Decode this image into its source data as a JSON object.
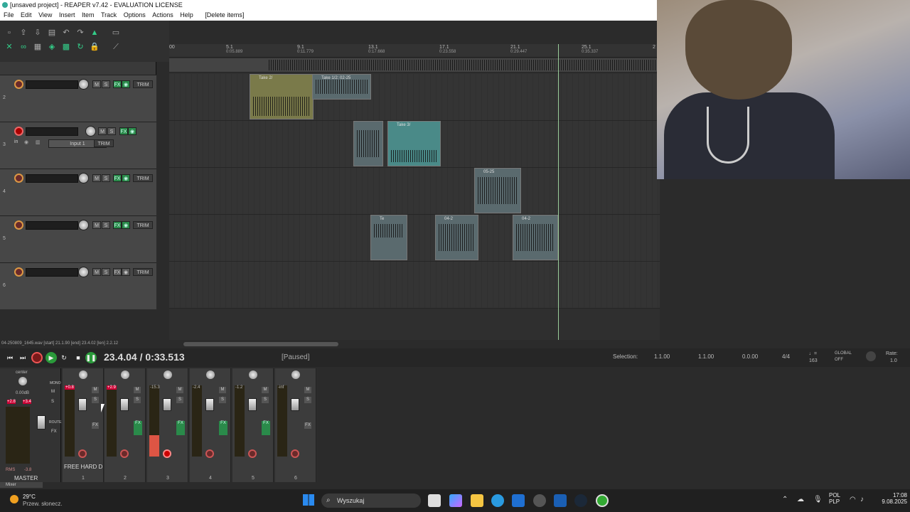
{
  "window": {
    "title": "[unsaved project] - REAPER v7.42 - EVALUATION LICENSE"
  },
  "menu": [
    "File",
    "Edit",
    "View",
    "Insert",
    "Item",
    "Track",
    "Options",
    "Actions",
    "Help",
    "[Delete items]"
  ],
  "ruler": {
    "ticks": [
      {
        "bar": "00",
        "time": ""
      },
      {
        "bar": "5.1",
        "time": "0:05.889"
      },
      {
        "bar": "9.1",
        "time": "0:11.779"
      },
      {
        "bar": "13.1",
        "time": "0:17.668"
      },
      {
        "bar": "17.1",
        "time": "0:23.558"
      },
      {
        "bar": "21.1",
        "time": "0:29.447"
      },
      {
        "bar": "25.1",
        "time": "0:35.337"
      },
      {
        "bar": "2",
        "time": ""
      }
    ]
  },
  "tracks": [
    {
      "num": "2",
      "armed": false,
      "trim": "TRIM"
    },
    {
      "num": "3",
      "armed": true,
      "trim": "TRIM",
      "input": "Input 1",
      "in_label": "in"
    },
    {
      "num": "4",
      "armed": false,
      "trim": "TRIM"
    },
    {
      "num": "5",
      "armed": false,
      "trim": "TRIM"
    },
    {
      "num": "6",
      "armed": false,
      "trim": "TRIM"
    }
  ],
  "items": [
    {
      "label": "Take 2/",
      "lane": 0
    },
    {
      "label": "Take 1/2: 02-25",
      "lane": 0
    },
    {
      "label": "",
      "lane": 1
    },
    {
      "label": "Take 3/",
      "lane": 1
    },
    {
      "label": "05-25",
      "lane": 2
    },
    {
      "label": "Te",
      "lane": 3
    },
    {
      "label": "04-2",
      "lane": 3
    },
    {
      "label": "04-2",
      "lane": 3
    }
  ],
  "status_line": "04-250809_1645.wav [start] 21.1.90 [end] 23.4.02 [len] 2.2.12",
  "transport": {
    "time": "23.4.04 / 0:33.513",
    "state": "[Paused]",
    "selection_label": "Selection:",
    "sel_start": "1.1.00",
    "sel_end": "1.1.00",
    "sel_len": "0.0.00",
    "timesig": "4/4",
    "bpm": "163",
    "global": "GLOBAL",
    "global_state": "OFF",
    "rate_label": "Rate:",
    "rate": "1.0"
  },
  "master": {
    "center": "center",
    "db": "0.00dB",
    "peak_l": "+2.8",
    "peak_r": "+3.4",
    "rms_label": "RMS",
    "rms": "-3.8",
    "label": "MASTER",
    "mono": "MONO",
    "route": "ROUTE"
  },
  "mixer_strips": [
    {
      "num": "1",
      "peak": "+0.8",
      "armed": false,
      "name": "FREE HARD D"
    },
    {
      "num": "2",
      "peak": "+2.9",
      "armed": false,
      "name": ""
    },
    {
      "num": "3",
      "peak": "-15.3",
      "armed": true,
      "name": ""
    },
    {
      "num": "4",
      "peak": "-2.4",
      "armed": false,
      "name": ""
    },
    {
      "num": "5",
      "peak": "-1.2",
      "armed": false,
      "name": ""
    },
    {
      "num": "6",
      "peak": "-inf",
      "armed": false,
      "name": ""
    }
  ],
  "mixer_tab": "Mixer",
  "taskbar": {
    "weather_temp": "29°C",
    "weather_desc": "Przew. słonecz.",
    "search_placeholder": "Wyszukaj",
    "lang1": "POL",
    "lang2": "PLP",
    "time": "17:08",
    "date": "9.08.2025"
  },
  "colors": {
    "accent_green": "#2a9a3a",
    "record_red": "#cc2244",
    "play_cursor": "#99cc99"
  }
}
